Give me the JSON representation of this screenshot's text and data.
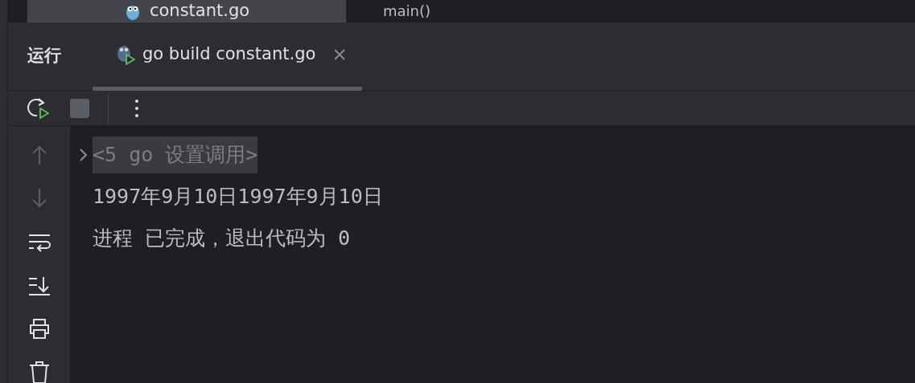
{
  "editor_tabs": [
    {
      "label": "constant.go",
      "selected": true
    }
  ],
  "breadcrumb": "main()",
  "run_panel": {
    "title": "运行",
    "tabs": [
      {
        "label": "go build constant.go",
        "selected": true
      }
    ]
  },
  "toolbar": [
    {
      "kind": "rerun",
      "disabled": false
    },
    {
      "kind": "stop",
      "disabled": true
    },
    {
      "kind": "more",
      "disabled": false
    }
  ],
  "gutter": [
    {
      "kind": "up",
      "disabled": true
    },
    {
      "kind": "down",
      "disabled": true
    },
    {
      "kind": "wrap",
      "disabled": false
    },
    {
      "kind": "scrollend",
      "disabled": false
    },
    {
      "kind": "print",
      "disabled": false
    },
    {
      "kind": "trash",
      "disabled": false
    }
  ],
  "console": [
    {
      "kind": "folded",
      "text": "<5 go 设置调用>",
      "expanded": false
    },
    {
      "kind": "output",
      "text": "1997年9月10日1997年9月10日"
    },
    {
      "kind": "output",
      "text": "进程 已完成，退出代码为 0"
    }
  ]
}
